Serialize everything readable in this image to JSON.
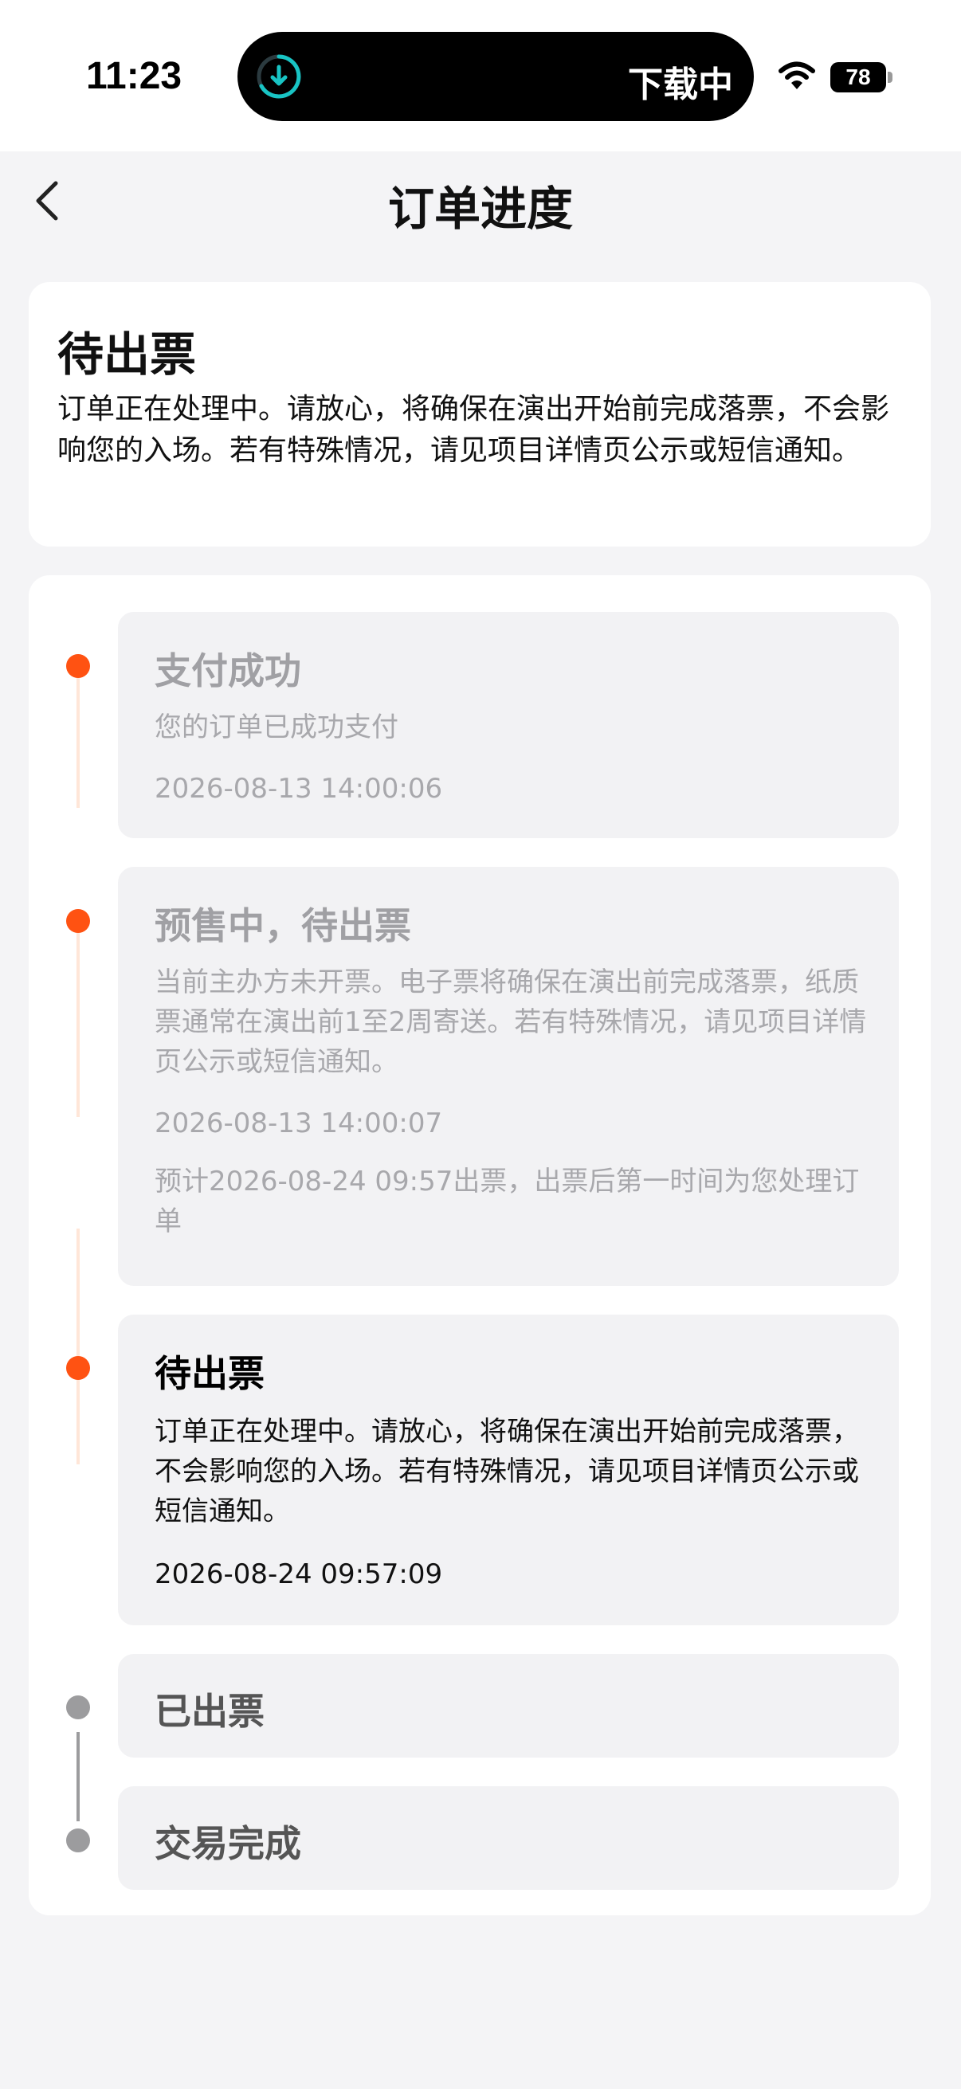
{
  "status_bar": {
    "time": "11:23",
    "island_text": "下载中",
    "battery": "78",
    "icons": [
      "download-icon",
      "wifi-icon",
      "battery-icon"
    ]
  },
  "nav": {
    "back_icon": "chevron-left-icon",
    "title": "订单进度"
  },
  "summary": {
    "title": "待出票",
    "description": "订单正在处理中。请放心，将确保在演出开始前完成落票，不会影响您的入场。若有特殊情况，请见项目详情页公示或短信通知。"
  },
  "timeline": {
    "steps": [
      {
        "title": "支付成功",
        "description": "您的订单已成功支付",
        "time": "2026-08-13 14:00:06",
        "state": "done"
      },
      {
        "title": "预售中，待出票",
        "description": "当前主办方未开票。电子票将确保在演出前完成落票，纸质票通常在演出前1至2周寄送。若有特殊情况，请见项目详情页公示或短信通知。",
        "time": "2026-08-13 14:00:07",
        "eta": "预计2026-08-24 09:57出票，出票后第一时间为您处理订单",
        "state": "done"
      },
      {
        "title": "待出票",
        "description": "订单正在处理中。请放心，将确保在演出开始前完成落票，不会影响您的入场。若有特殊情况，请见项目详情页公示或短信通知。",
        "time": "2026-08-24 09:57:09",
        "state": "current"
      },
      {
        "title": "已出票",
        "state": "pending"
      },
      {
        "title": "交易完成",
        "state": "pending"
      }
    ]
  },
  "colors": {
    "accent": "#ff5212",
    "pending": "#9c9c9e",
    "card_bg": "#ffffff",
    "page_bg": "#f4f4f6"
  }
}
